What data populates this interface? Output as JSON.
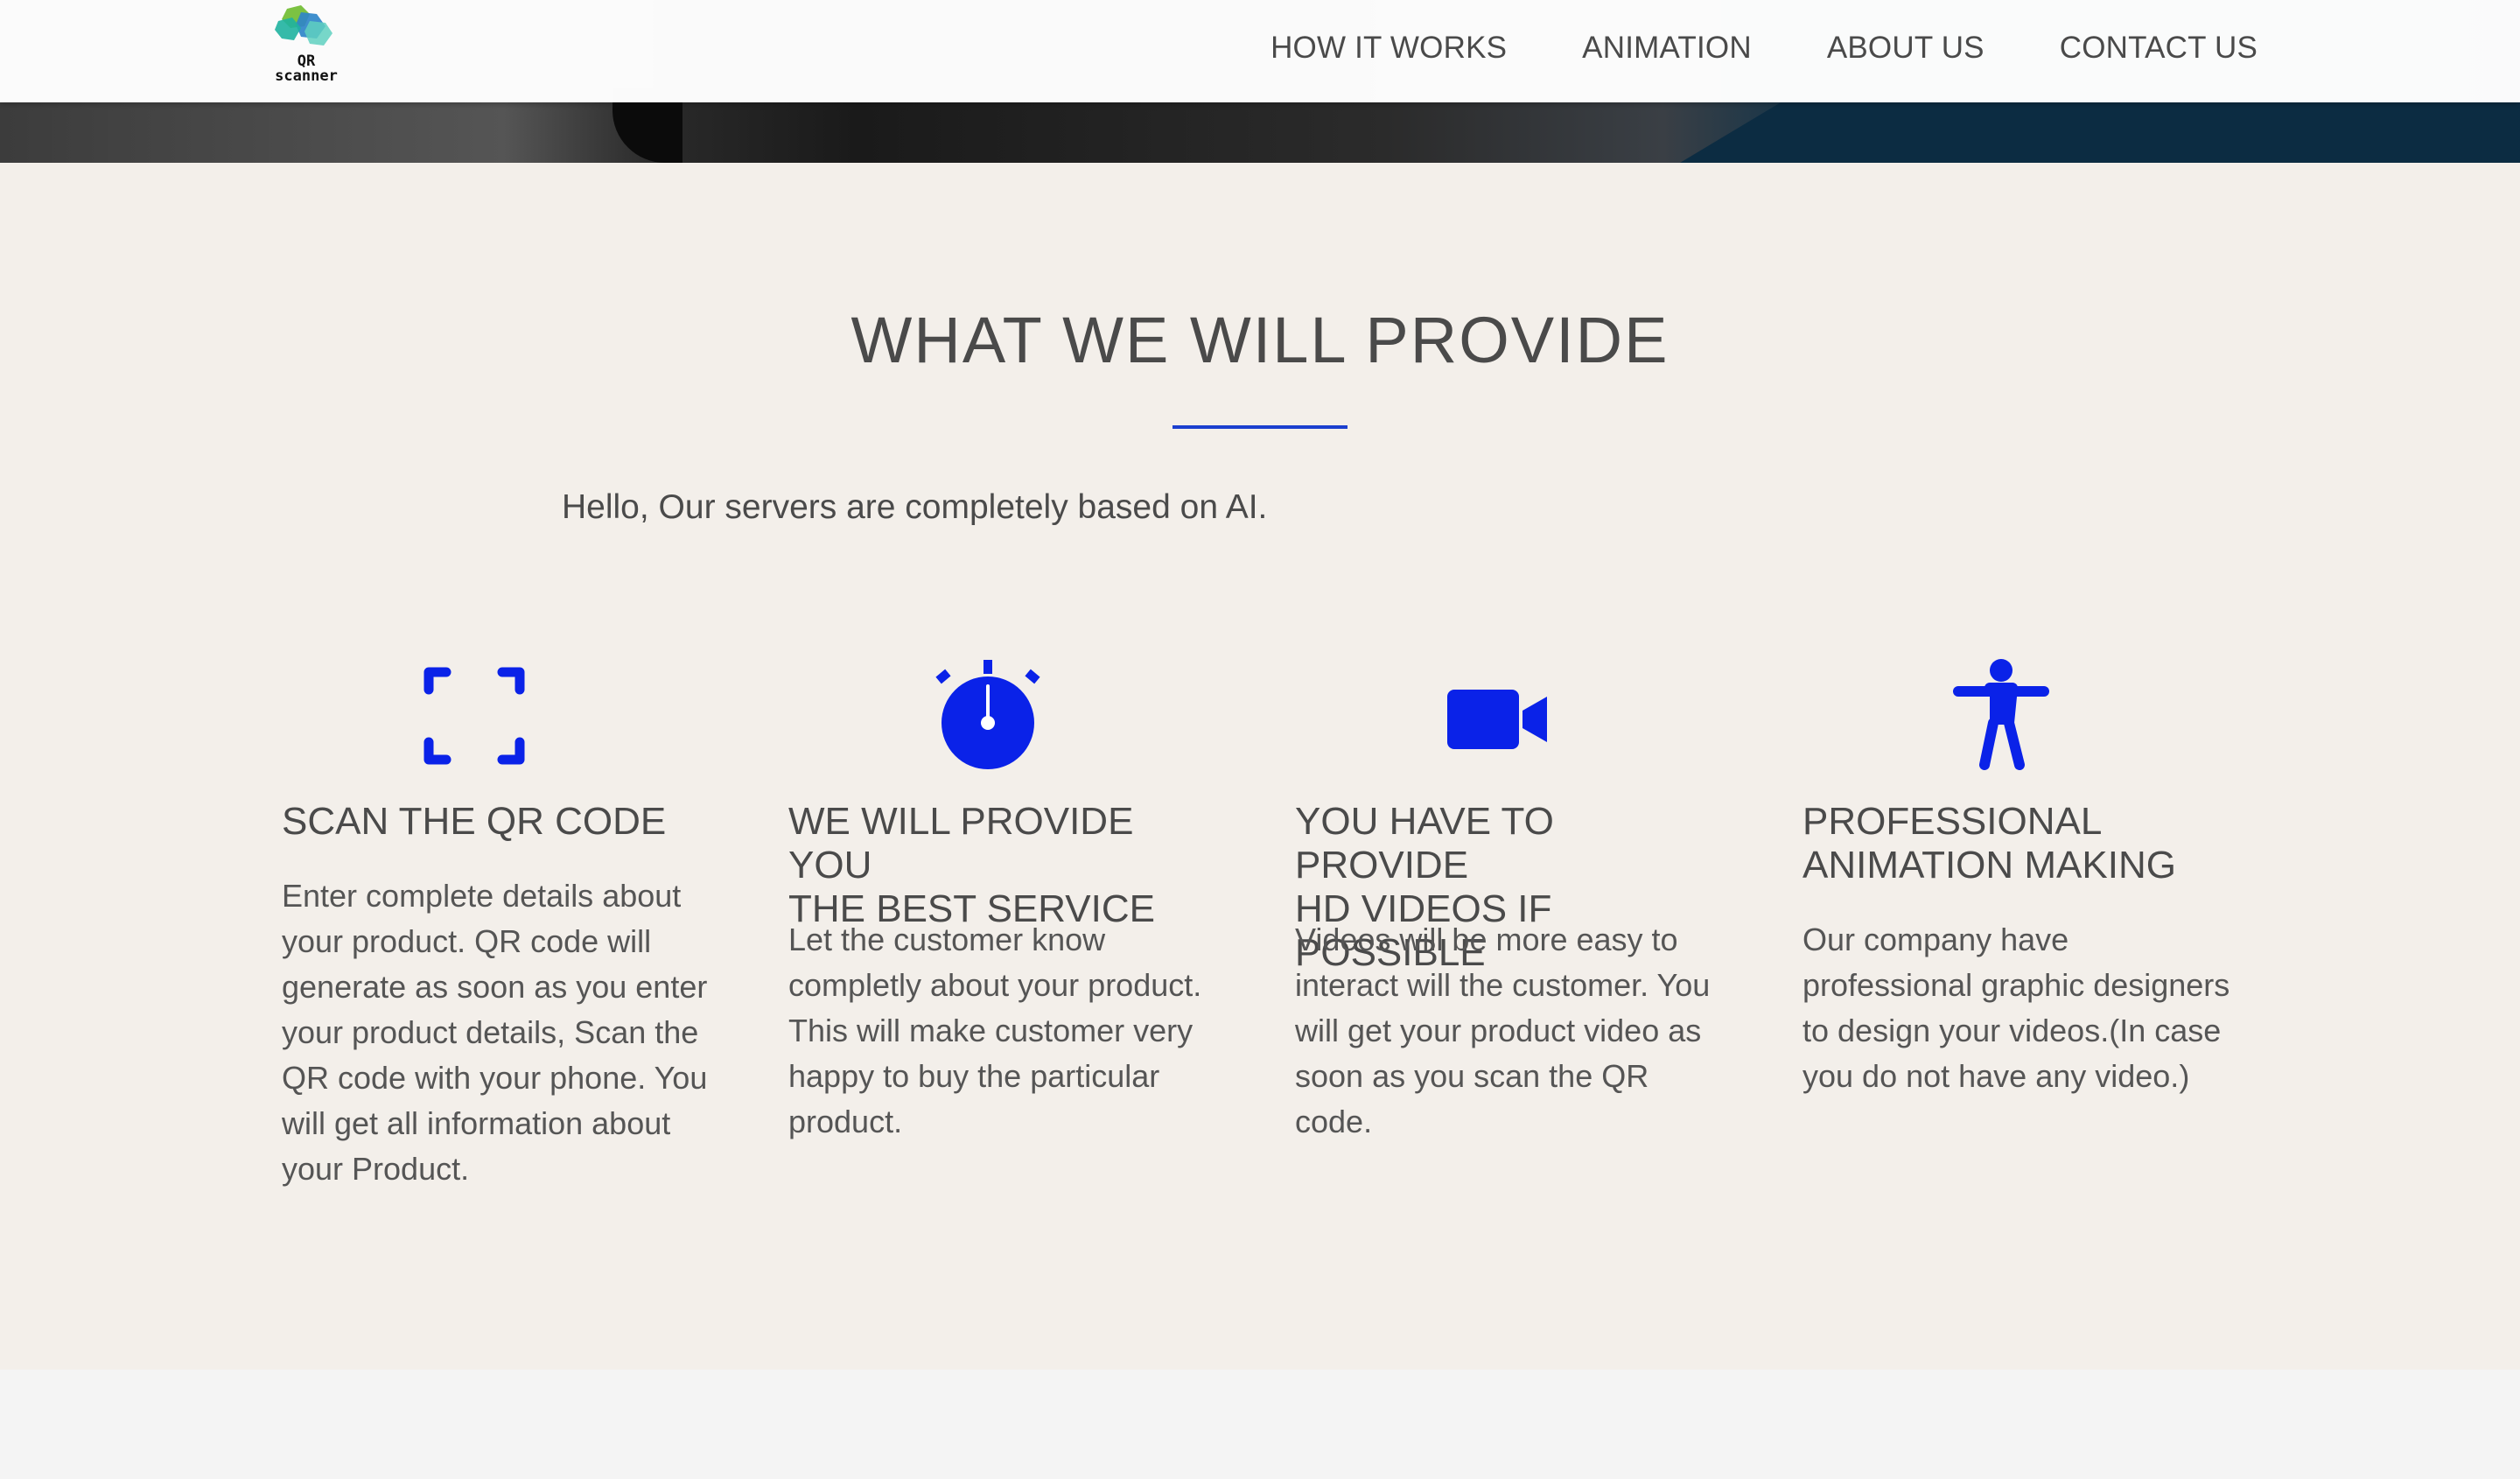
{
  "brand": {
    "logo_text_line1": "QR",
    "logo_text_line2": "scanner"
  },
  "nav": {
    "items": [
      {
        "label": "HOW IT WORKS"
      },
      {
        "label": "ANIMATION"
      },
      {
        "label": "ABOUT US"
      },
      {
        "label": "CONTACT US"
      }
    ]
  },
  "section": {
    "title": "WHAT WE WILL PROVIDE",
    "intro": "Hello, Our servers are completely based on AI.",
    "accent_color": "#0a22e8"
  },
  "features": [
    {
      "icon": "scan-frame-icon",
      "title_line1": "SCAN THE QR CODE",
      "title_line2": "",
      "body": "Enter complete details about your product. QR code will generate as soon as you enter your product details, Scan the QR code with your phone. You will get all information about your Product."
    },
    {
      "icon": "stopwatch-icon",
      "title_line1": "WE WILL PROVIDE YOU",
      "title_line2": "THE BEST SERVICE",
      "body": "Let the customer know completly about your product. This will make customer very happy to buy the particular product."
    },
    {
      "icon": "video-camera-icon",
      "title_line1": "YOU HAVE TO PROVIDE",
      "title_line2": "HD VIDEOS IF POSSIBLE",
      "body": "Videos will be more easy to interact will the customer. You will get your product video as soon as you scan the QR code."
    },
    {
      "icon": "accessibility-person-icon",
      "title_line1": "PROFESSIONAL",
      "title_line2": "ANIMATION MAKING",
      "body": "Our company have professional graphic designers to design your videos.(In case you do not have any video.)"
    }
  ]
}
